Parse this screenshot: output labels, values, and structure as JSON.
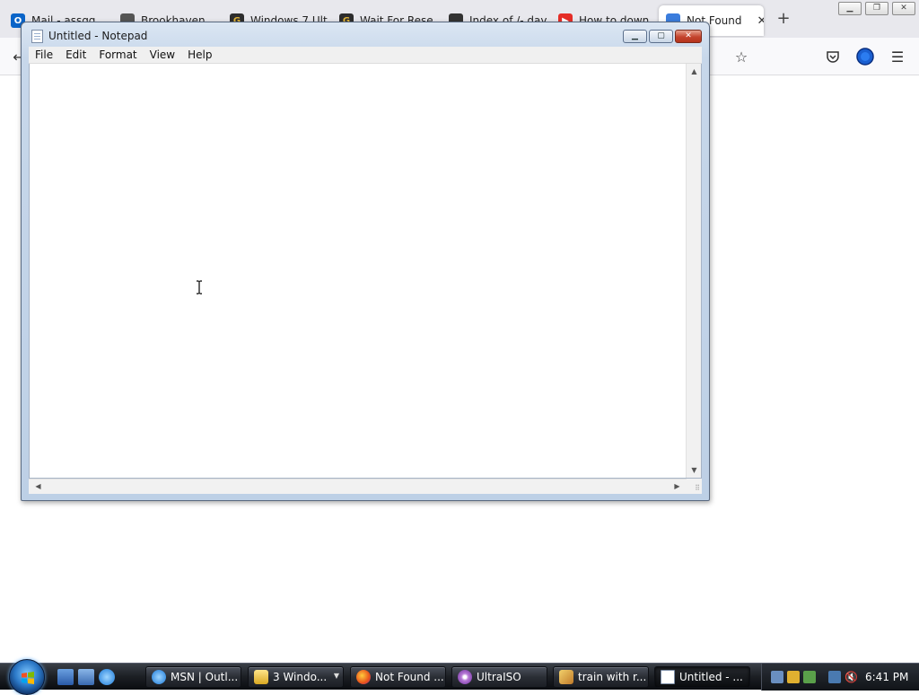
{
  "browser": {
    "tabs": [
      {
        "label": "Mail - assgg",
        "icon": "outlook-icon",
        "color": "#0a64c8"
      },
      {
        "label": "Brookhaven",
        "icon": "game-icon",
        "color": "#555555"
      },
      {
        "label": "Windows 7 Ult",
        "icon": "seal-icon",
        "color": "#2d2d2d"
      },
      {
        "label": "Wait For Rese",
        "icon": "seal-icon",
        "color": "#2d2d2d"
      },
      {
        "label": "Index of /- day",
        "icon": "server-icon",
        "color": "#333333"
      },
      {
        "label": "How to down",
        "icon": "youtube-icon",
        "color": "#e52d27"
      },
      {
        "label": "Not Found",
        "icon": "page-icon",
        "color": "#3b7ddd",
        "active": true
      }
    ],
    "new_tab_symbol": "+",
    "window_controls": [
      "minimize",
      "restore",
      "close"
    ]
  },
  "notepad": {
    "title": "Untitled - Notepad",
    "menu": [
      "File",
      "Edit",
      "Format",
      "View",
      "Help"
    ],
    "content": ""
  },
  "taskbar": {
    "quick_launch": [
      "show-desktop-icon",
      "switch-windows-icon",
      "internet-explorer-icon"
    ],
    "buttons": [
      {
        "label": "MSN | Outl...",
        "icon": "internet-explorer-icon"
      },
      {
        "label": "3 Windo...",
        "icon": "folder-icon",
        "dropdown": true
      },
      {
        "label": "Not Found ...",
        "icon": "firefox-icon"
      },
      {
        "label": "UltraISO",
        "icon": "disc-icon"
      },
      {
        "label": "train with r...",
        "icon": "paint-icon"
      },
      {
        "label": "Untitled - ...",
        "icon": "notepad-icon",
        "active": true
      }
    ],
    "clock": "6:41 PM"
  },
  "colors": {
    "taskbar_top": "#3a3f47",
    "notepad_frame": "#c7d7ea",
    "close_red": "#c4442d"
  }
}
